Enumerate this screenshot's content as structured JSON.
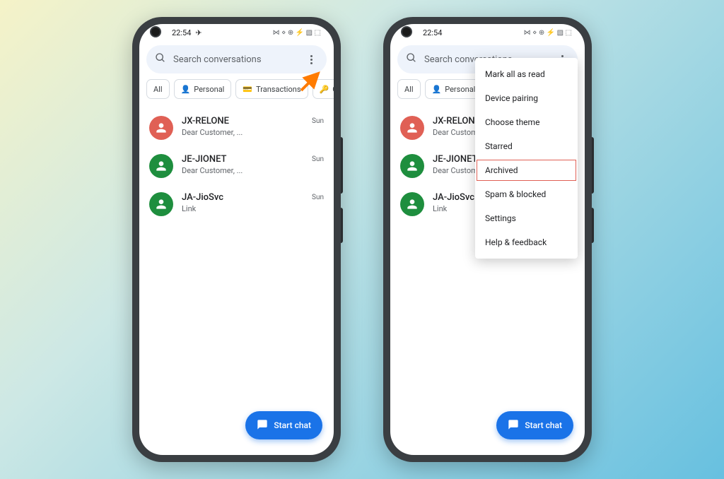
{
  "status": {
    "time": "22:54",
    "right": "⋈ ⋄ ⊕ ⚡ ▧ ⬚"
  },
  "search": {
    "placeholder": "Search conversations"
  },
  "chips": [
    {
      "label": "All",
      "icon": ""
    },
    {
      "label": "Personal",
      "icon": "person"
    },
    {
      "label": "Transactions",
      "icon": "card"
    },
    {
      "label": "OTPs",
      "icon": "key"
    }
  ],
  "conversations": [
    {
      "name": "JX-RELONE",
      "preview": "Dear Customer, ...",
      "time": "Sun",
      "avatar": "red"
    },
    {
      "name": "JE-JIONET",
      "preview": "Dear Customer, ...",
      "time": "Sun",
      "avatar": "green"
    },
    {
      "name": "JA-JioSvc",
      "preview": "Link",
      "time": "Sun",
      "avatar": "green"
    }
  ],
  "fab": {
    "label": "Start chat"
  },
  "menu": [
    {
      "label": "Mark all as read",
      "hl": false
    },
    {
      "label": "Device pairing",
      "hl": false
    },
    {
      "label": "Choose theme",
      "hl": false
    },
    {
      "label": "Starred",
      "hl": false
    },
    {
      "label": "Archived",
      "hl": true
    },
    {
      "label": "Spam & blocked",
      "hl": false
    },
    {
      "label": "Settings",
      "hl": false
    },
    {
      "label": "Help & feedback",
      "hl": false
    }
  ]
}
